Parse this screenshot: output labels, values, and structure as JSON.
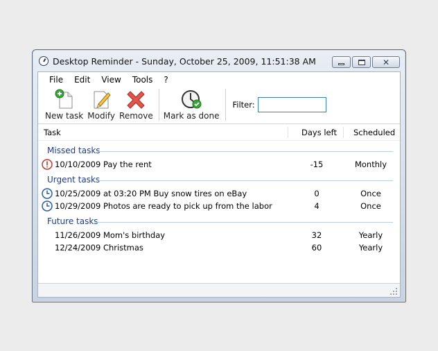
{
  "window": {
    "title": "Desktop Reminder - Sunday, October 25, 2009, 11:51:38 AM",
    "controls": {
      "minimize": "minimize",
      "maximize": "maximize",
      "close": "✕"
    }
  },
  "menu": [
    "File",
    "Edit",
    "View",
    "Tools",
    "?"
  ],
  "toolbar": {
    "new_task": "New task",
    "modify": "Modify",
    "remove": "Remove",
    "mark_done": "Mark as done",
    "filter_label": "Filter:",
    "filter_value": ""
  },
  "columns": {
    "task": "Task",
    "days_left": "Days left",
    "scheduled": "Scheduled"
  },
  "groups": [
    {
      "title": "Missed tasks",
      "icon": "warning-icon",
      "rows": [
        {
          "task": "10/10/2009 Pay the rent",
          "days": "-15",
          "scheduled": "Monthly"
        }
      ]
    },
    {
      "title": "Urgent tasks",
      "icon": "clock-icon",
      "rows": [
        {
          "task": "10/25/2009 at 03:20 PM Buy snow tires on eBay",
          "days": "0",
          "scheduled": "Once"
        },
        {
          "task": "10/29/2009 Photos are ready to pick up from the labor",
          "days": "4",
          "scheduled": "Once"
        }
      ]
    },
    {
      "title": "Future tasks",
      "icon": "",
      "rows": [
        {
          "task": "11/26/2009 Mom's birthday",
          "days": "32",
          "scheduled": "Yearly"
        },
        {
          "task": "12/24/2009 Christmas",
          "days": "60",
          "scheduled": "Yearly"
        }
      ]
    }
  ],
  "colors": {
    "group_title": "#1f3b87",
    "accent": "#3c7fb1"
  }
}
